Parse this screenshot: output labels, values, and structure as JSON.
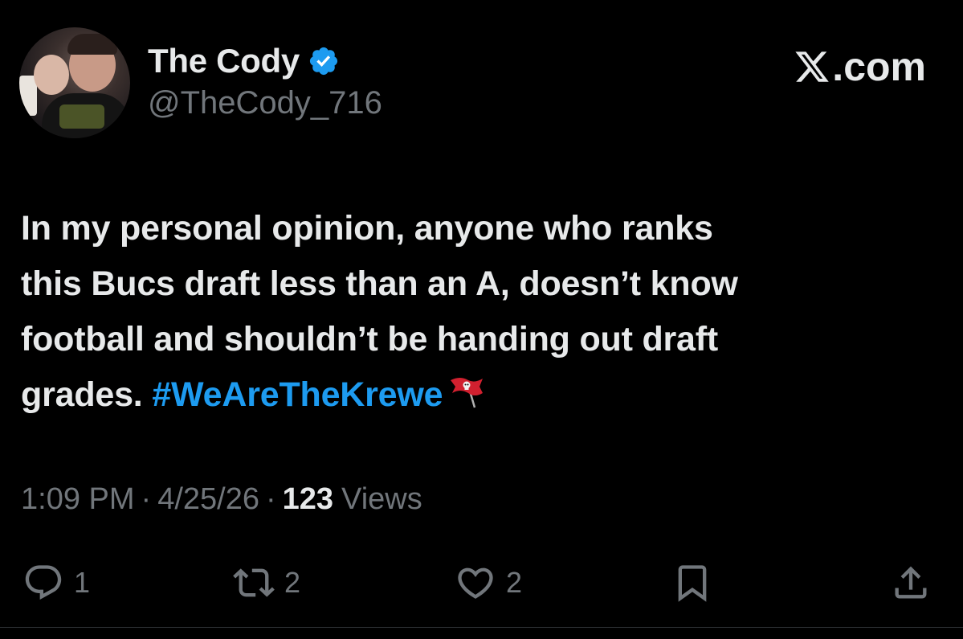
{
  "author": {
    "display_name": "The Cody",
    "handle": "@TheCody_716",
    "verified": true
  },
  "site": {
    "logo_text": ".com"
  },
  "tweet": {
    "text_line1": "In my personal opinion, anyone who ranks",
    "text_line2": "this Bucs draft less than an A, doesn’t know",
    "text_line3": "football and shouldn’t be handing out draft",
    "text_line4_prefix": "grades. ",
    "hashtag": "#WeAreTheKrewe",
    "emoji": "buccaneers-flag"
  },
  "meta": {
    "time": "1:09 PM",
    "separator": "·",
    "date": "4/25/26",
    "views_count": "123",
    "views_label": "Views"
  },
  "actions": {
    "replies": "1",
    "reposts": "2",
    "likes": "2"
  },
  "icons": {
    "verified": "verified-badge-icon",
    "x_logo": "x-logo-icon",
    "reply": "reply-icon",
    "repost": "repost-icon",
    "like": "heart-icon",
    "bookmark": "bookmark-icon",
    "share": "share-icon"
  },
  "colors": {
    "background": "#000000",
    "text_primary": "#e7e9ea",
    "text_secondary": "#71767b",
    "accent": "#1d9bf0"
  }
}
